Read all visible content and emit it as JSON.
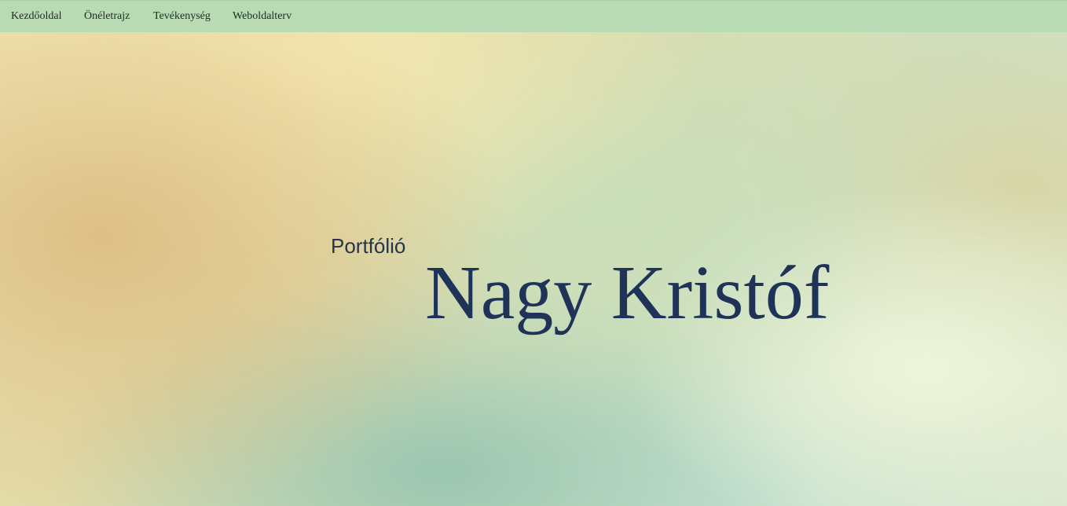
{
  "nav": {
    "items": [
      {
        "label": "Kezdőoldal"
      },
      {
        "label": "Önéletrajz"
      },
      {
        "label": "Tevékenység"
      },
      {
        "label": "Weboldalterv"
      }
    ]
  },
  "hero": {
    "subtitle": "Portfólió",
    "title": "Nagy Kristóf"
  },
  "colors": {
    "navbar": "#b8dbb3",
    "title_text": "#1f3359",
    "nav_text": "#1e2a24"
  }
}
